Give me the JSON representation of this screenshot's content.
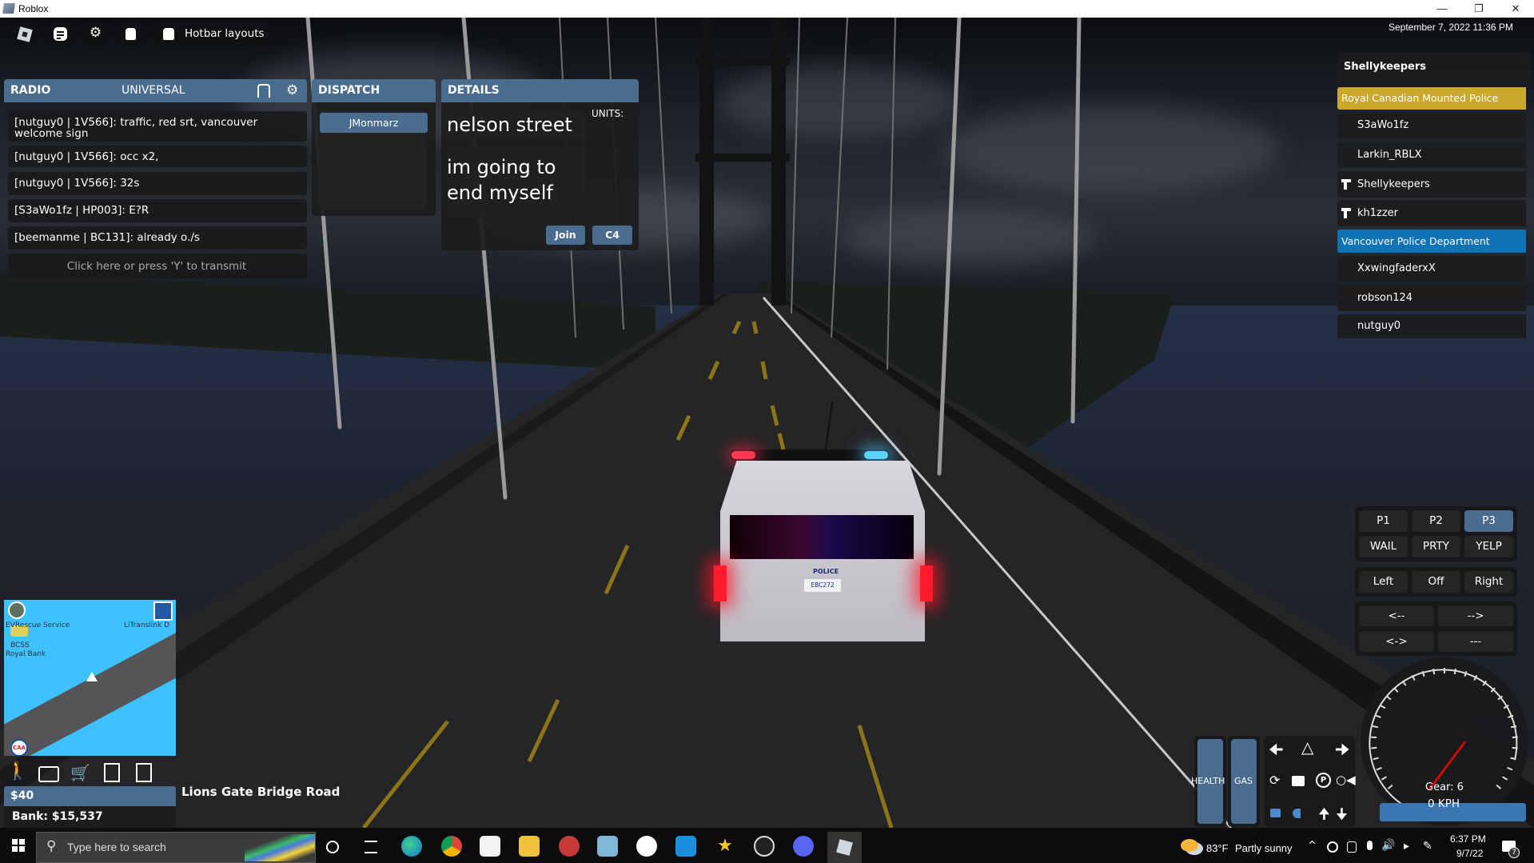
{
  "window": {
    "title": "Roblox",
    "controls": [
      "minimize",
      "restore",
      "close"
    ]
  },
  "hotbar": {
    "buttons": [
      {
        "icon": "roblox-logo-icon"
      },
      {
        "icon": "chat-icon"
      },
      {
        "icon": "gear-icon"
      },
      {
        "icon": "backpack-icon"
      }
    ],
    "layouts_label": "Hotbar layouts"
  },
  "datetime": "September 7, 2022 11:36 PM",
  "radio": {
    "title": "RADIO",
    "channel": "UNIVERSAL",
    "messages": [
      "[nutguy0 | 1V566]: traffic, red srt, vancouver welcome sign",
      "[nutguy0 | 1V566]: occ x2,",
      "[nutguy0 | 1V566]: 32s",
      "[S3aWo1fz | HP003]: E?R",
      "[beemanme | BC131]: already o./s"
    ],
    "transmit_label": "Click here or press 'Y' to transmit"
  },
  "dispatch": {
    "title": "DISPATCH",
    "callers": [
      "JMonmarz"
    ]
  },
  "details": {
    "title": "DETAILS",
    "location": "nelson street",
    "description": "im going to end myself",
    "units_label": "UNITS:",
    "join_label": "Join",
    "code_label": "C4"
  },
  "player_list": {
    "local_player": "Shellykeepers",
    "teams": [
      {
        "name": "Royal Canadian Mounted Police",
        "color": "#c9a82c",
        "players": [
          {
            "name": "S3aWo1fz",
            "icon": null
          },
          {
            "name": "Larkin_RBLX",
            "icon": null
          },
          {
            "name": "Shellykeepers",
            "icon": "hammer-icon"
          },
          {
            "name": "kh1zzer",
            "icon": "hammer-icon"
          }
        ]
      },
      {
        "name": "Vancouver Police Department",
        "color": "#0f73b4",
        "players": [
          {
            "name": "XxwingfaderxX",
            "icon": null
          },
          {
            "name": "robson124",
            "icon": null
          },
          {
            "name": "nutguy0",
            "icon": null
          }
        ]
      }
    ]
  },
  "siren": {
    "patterns": [
      "P1",
      "P2",
      "P3"
    ],
    "active_pattern": "P3",
    "tones": [
      "WAIL",
      "PRTY",
      "YELP"
    ],
    "indicators": [
      "Left",
      "Off",
      "Right"
    ],
    "arrows": [
      "<--",
      "-->",
      "<->",
      "---"
    ],
    "accent": "#4a6c8f"
  },
  "vehicle": {
    "health_label": "HEALTH",
    "gas_label": "GAS",
    "health_level": 1.0,
    "gas_level": 1.0,
    "controls": [
      "left-arrow-icon",
      "hazard-icon",
      "right-arrow-icon",
      "cycle-icon",
      "radio-icon",
      "parking-brake-icon",
      "horn-icon",
      "lock-icon",
      "headlight-icon",
      "up-arrow-icon",
      "down-arrow-icon"
    ],
    "gear_label": "Gear: 6",
    "speed_label": "0 KPH",
    "speed_kph": 0
  },
  "minimap": {
    "labels": [
      "EVRescue Service",
      "LiTranslink D",
      "BCSS",
      "Royal Bank"
    ],
    "water_color": "#3fc1ff"
  },
  "toolbar": {
    "icons": [
      "walk-icon",
      "briefcase-icon",
      "cart-icon",
      "list-car-icon",
      "list-upload-icon"
    ]
  },
  "money": {
    "cash": "$40",
    "bank": "Bank: $15,537"
  },
  "street": "Lions Gate Bridge Road",
  "vehicle_plate": "EBC272",
  "vehicle_decal": "POLICE",
  "taskbar": {
    "search_placeholder": "Type here to search",
    "apps": [
      "chrome",
      "microsoft-store",
      "file-explorer",
      "snipping-tool",
      "notepad",
      "signal",
      "mail",
      "star-app",
      "obs",
      "discord",
      "roblox"
    ],
    "weather": {
      "temp": "83°F",
      "condition": "Partly sunny"
    },
    "clock": {
      "time": "6:37 PM",
      "date": "9/7/22"
    },
    "notification_count": "7"
  }
}
